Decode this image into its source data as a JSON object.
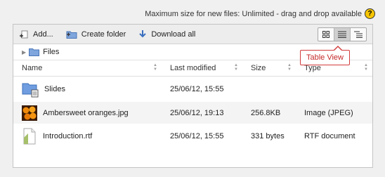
{
  "header": {
    "max_size_note": "Maximum size for new files: Unlimited - drag and drop available",
    "help_icon": "help-icon"
  },
  "toolbar": {
    "add_label": "Add...",
    "create_folder_label": "Create folder",
    "download_all_label": "Download all",
    "views": [
      "icon-view",
      "table-view",
      "tree-view"
    ],
    "active_view": "table-view"
  },
  "tooltip": {
    "label": "Table View",
    "color": "#c62828"
  },
  "path": {
    "label": "Files"
  },
  "table": {
    "columns": [
      "Name",
      "Last modified",
      "Size",
      "Type"
    ],
    "rows": [
      {
        "name": "Slides",
        "modified": "25/06/12, 15:55",
        "size": "",
        "type": "",
        "icon": "folder-icon"
      },
      {
        "name": "Ambersweet oranges.jpg",
        "modified": "25/06/12, 19:13",
        "size": "256.8KB",
        "type": "Image (JPEG)",
        "icon": "image-thumbnail-icon"
      },
      {
        "name": "Introduction.rtf",
        "modified": "25/06/12, 15:55",
        "size": "331 bytes",
        "type": "RTF document",
        "icon": "document-icon"
      }
    ]
  }
}
